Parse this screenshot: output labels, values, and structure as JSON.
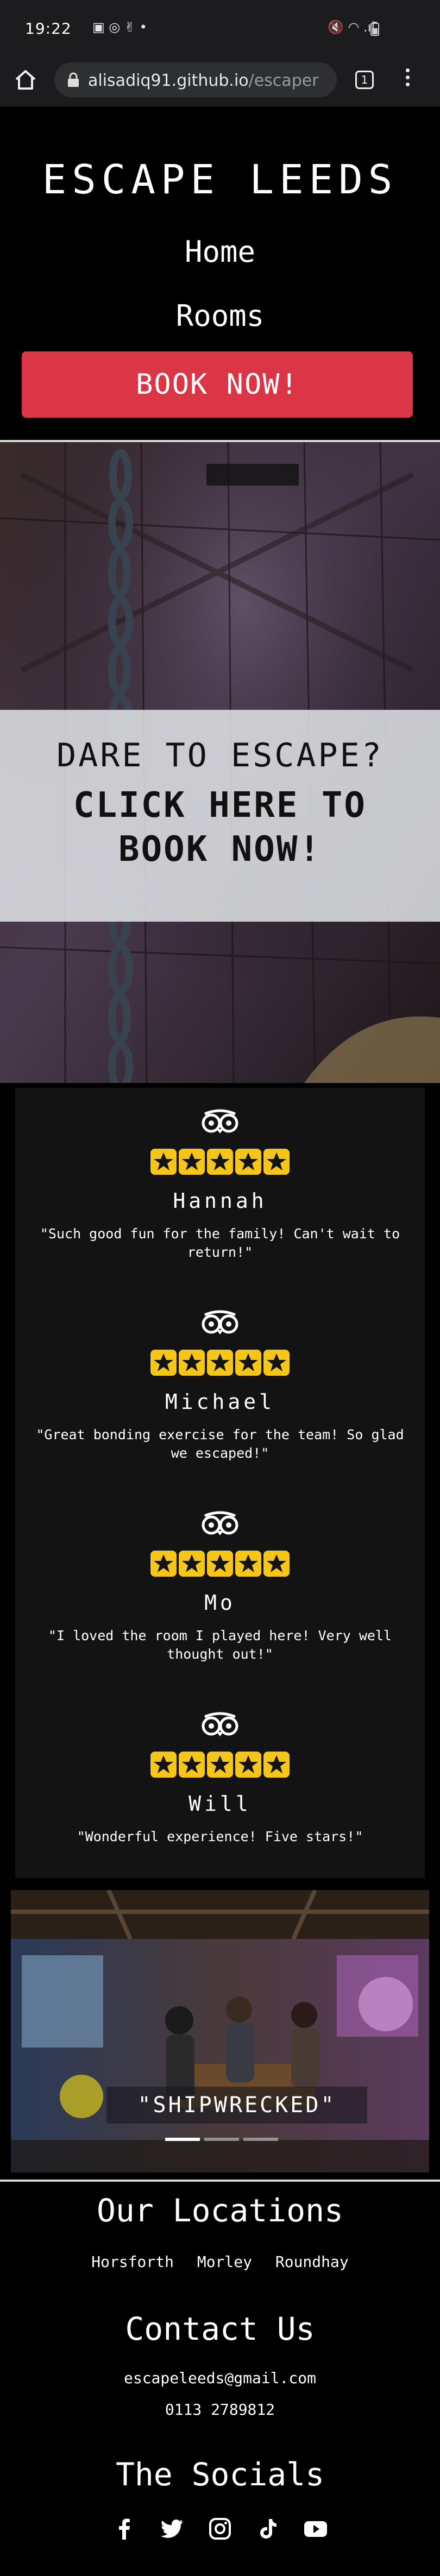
{
  "status_bar": {
    "time": "19:22",
    "left_icons": "▣ ◎ ✌ •",
    "right_icons": "🔇 ◠ .ıl"
  },
  "browser": {
    "url_host": "alisadiq91.github.io",
    "url_path": "/escaper",
    "tab_count": "1"
  },
  "header": {
    "brand": "ESCAPE LEEDS",
    "nav": [
      "Home",
      "Rooms"
    ],
    "book_button": "BOOK NOW!"
  },
  "hero": {
    "line1": "DARE TO ESCAPE?",
    "line2": "CLICK HERE TO",
    "line3": "BOOK NOW!"
  },
  "reviews": [
    {
      "name": "Hannah",
      "quote": "\"Such good fun for the family! Can't wait to return!\"",
      "stars": 5
    },
    {
      "name": "Michael",
      "quote": "\"Great bonding exercise for the team! So glad we escaped!\"",
      "stars": 5
    },
    {
      "name": "Mo",
      "quote": "\"I loved the room I played here! Very well thought out!\"",
      "stars": 5
    },
    {
      "name": "Will",
      "quote": "\"Wonderful experience! Five stars!\"",
      "stars": 5
    }
  ],
  "carousel": {
    "caption": "\"SHIPWRECKED\"",
    "slides": 3,
    "active_slide": 1
  },
  "footer": {
    "locations_title": "Our Locations",
    "locations": [
      "Horsforth",
      "Morley",
      "Roundhay"
    ],
    "contact_title": "Contact Us",
    "email": "escapeleeds@gmail.com",
    "phone": "0113 2789812",
    "socials_title": "The Socials",
    "socials": [
      "facebook-icon",
      "twitter-icon",
      "instagram-icon",
      "tiktok-icon",
      "youtube-icon"
    ]
  },
  "colors": {
    "accent": "#dc3545",
    "star": "#f5c518",
    "background": "#000000",
    "card": "#131313"
  }
}
